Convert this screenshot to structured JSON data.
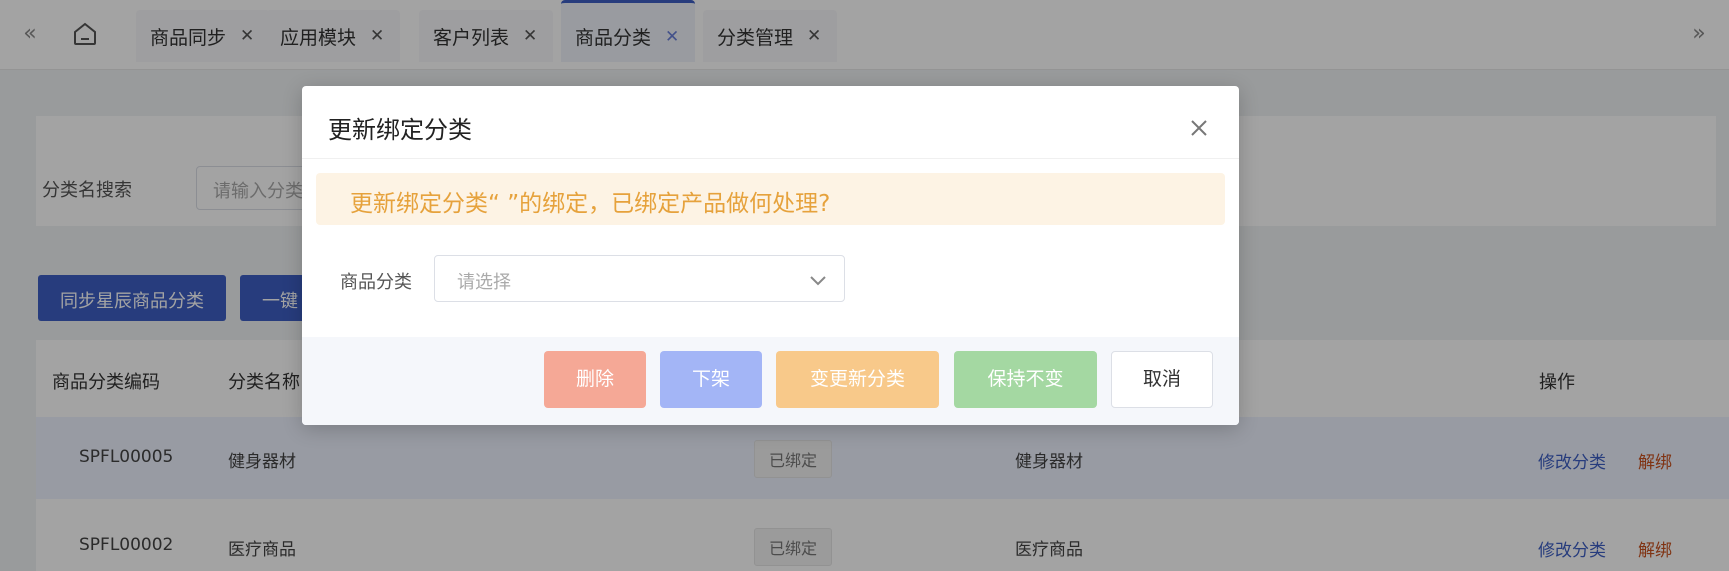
{
  "tabs": [
    {
      "label": "商品同步"
    },
    {
      "label": "应用模块"
    },
    {
      "label": "客户列表"
    },
    {
      "label": "商品分类",
      "active": true
    },
    {
      "label": "分类管理"
    }
  ],
  "search": {
    "label": "分类名搜索",
    "placeholder": "请输入分类"
  },
  "toolbar": {
    "sync_button": "同步星辰商品分类",
    "second_button": "一键"
  },
  "table": {
    "headers": {
      "code": "商品分类编码",
      "name": "分类名称",
      "action": "操作"
    },
    "rows": [
      {
        "code": "SPFL00005",
        "name": "健身器材",
        "status": "已绑定",
        "bound_name": "健身器材",
        "edit": "修改分类",
        "unbind": "解绑"
      },
      {
        "code": "SPFL00002",
        "name": "医疗商品",
        "status": "已绑定",
        "bound_name": "医疗商品",
        "edit": "修改分类",
        "unbind": "解绑"
      }
    ]
  },
  "dialog": {
    "title": "更新绑定分类",
    "alert": "更新绑定分类“ ”的绑定，已绑定产品做何处理?",
    "form_label": "商品分类",
    "select_placeholder": "请选择",
    "buttons": {
      "delete": "删除",
      "offline": "下架",
      "change": "变更新分类",
      "keep": "保持不变",
      "cancel": "取消"
    }
  },
  "colors": {
    "primary": "#3d5fc4",
    "warning_text": "#e6a23c",
    "warning_bg": "#fdf3e4",
    "danger_link": "#c8511e"
  }
}
